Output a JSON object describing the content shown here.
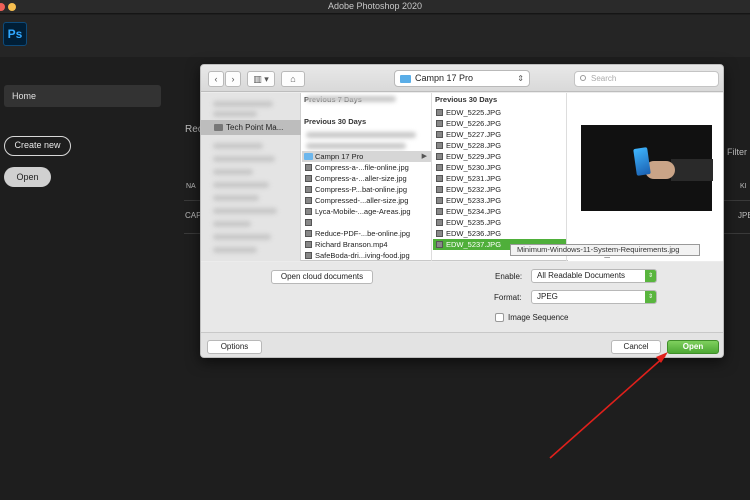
{
  "window": {
    "title": "Adobe Photoshop 2020"
  },
  "app": {
    "logo": "Ps",
    "home_label": "Home",
    "create_new_label": "Create new",
    "open_label": "Open",
    "background_fragments": {
      "recent": "Rec",
      "filter": "Filter",
      "col_name": "NA",
      "col_kind": "KI",
      "row_name": "CAP",
      "row_kind": "JPE"
    }
  },
  "dialog": {
    "location": "Campn 17 Pro",
    "search_placeholder": "Search",
    "sidebar_selected": "Tech Point Ma...",
    "col1": {
      "sections": [
        "Previous 7 Days",
        "Previous 30 Days"
      ],
      "items": [
        "Campn 17 Pro",
        "Compress-a-...file-online.jpg",
        "Compress-a-...aller-size.jpg",
        "Compress-P...bat-online.jpg",
        "Compressed-...aller-size.jpg",
        "Lyca-Mobile-...age-Areas.jpg",
        "Minimum-Windows-11-System-Requirements.jpg",
        "Reduce-PDF-...be-online.jpg",
        "Richard Branson.mp4",
        "SafeBoda-dri...iving-food.jpg"
      ]
    },
    "col2": {
      "section": "Previous 30 Days",
      "items": [
        "EDW_5225.JPG",
        "EDW_5226.JPG",
        "EDW_5227.JPG",
        "EDW_5228.JPG",
        "EDW_5229.JPG",
        "EDW_5230.JPG",
        "EDW_5231.JPG",
        "EDW_5232.JPG",
        "EDW_5233.JPG",
        "EDW_5234.JPG",
        "EDW_5235.JPG",
        "EDW_5236.JPG",
        "EDW_5237.JPG"
      ]
    },
    "preview_name": "EDW_5237.JPG",
    "cloud_button": "Open cloud documents",
    "enable_label": "Enable:",
    "enable_value": "All Readable Documents",
    "format_label": "Format:",
    "format_value": "JPEG",
    "image_sequence_label": "Image Sequence",
    "options_button": "Options",
    "cancel_button": "Cancel",
    "open_button": "Open"
  },
  "colors": {
    "accent_green": "#4faf3a",
    "arrow_red": "#e0201b",
    "ps_blue": "#31a8ff"
  }
}
